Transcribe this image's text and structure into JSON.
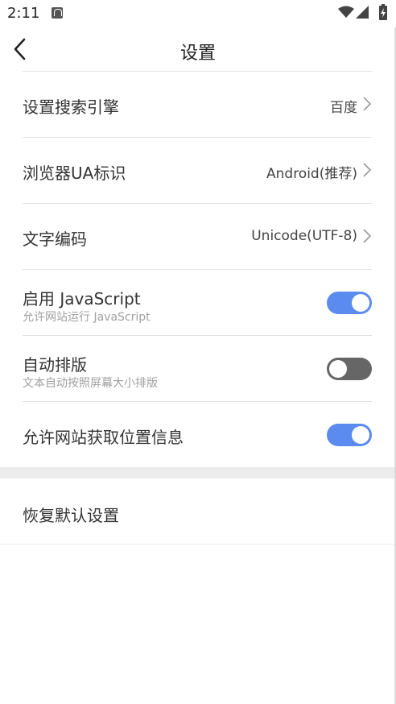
{
  "status_bar": {
    "time": "2:11",
    "icons": [
      "notification-icon",
      "wifi-icon",
      "signal-icon",
      "battery-icon"
    ]
  },
  "header": {
    "title": "设置",
    "back_icon": "chevron-left-icon"
  },
  "settings": [
    {
      "id": "search-engine",
      "title": "设置搜索引擎",
      "value": "百度",
      "icon": "chevron-right-icon"
    },
    {
      "id": "user-agent",
      "title": "浏览器UA标识",
      "value": "Android(推荐)",
      "icon": "chevron-right-icon"
    },
    {
      "id": "text-encoding",
      "title": "文字编码",
      "value": "Unicode(UTF-8)",
      "icon": "chevron-right-icon"
    },
    {
      "id": "javascript",
      "title": "启用 JavaScript",
      "subtitle": "允许网站运行 JavaScript",
      "enabled": true
    },
    {
      "id": "auto-layout",
      "title": "自动排版",
      "subtitle": "文本自动按照屏幕大小排版",
      "enabled": false
    },
    {
      "id": "location",
      "title": "允许网站获取位置信息",
      "enabled": true
    }
  ],
  "reset": {
    "label": "恢复默认设置"
  },
  "colors": {
    "toggle_on": "#5b8bef",
    "toggle_off": "#666666",
    "divider": "#e3e3e3",
    "subtitle": "#a0a0a0"
  }
}
